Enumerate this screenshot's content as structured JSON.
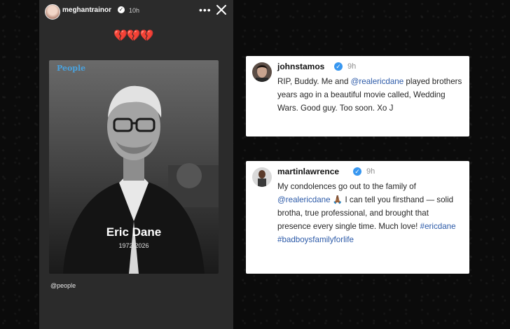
{
  "story": {
    "username": "meghantrainor",
    "time": "10h",
    "more_label": "•••",
    "hearts": "💔💔💔",
    "logo": "People",
    "caption_name": "Eric Dane",
    "caption_years": "1972-2026",
    "credit": "@people"
  },
  "comments": [
    {
      "username": "johnstamos",
      "time": "9h",
      "text_parts": [
        "RIP, Buddy.  Me and ",
        "@realericdane",
        " played brothers years ago in a beautiful movie called, Wedding Wars.  Good guy.  Too soon. Xo J"
      ]
    },
    {
      "username": "martinlawrence",
      "time": "9h",
      "text_parts": [
        "My condolences go out to the family of ",
        "@realericdane",
        " 🙏🏾 I can tell you firsthand — solid brotha, true professional, and brought that presence every single time. Much love! ",
        "#ericdane",
        " ",
        "#badboysfamilyforlife"
      ]
    }
  ],
  "colors": {
    "background": "#0b0b0b",
    "story_bg": "#2b2b2b",
    "verified_blue": "#3897f0",
    "mention_blue": "#2c5aa8",
    "heart_red": "#e63946"
  },
  "icons": {
    "close": "close-icon",
    "more": "more-options-icon",
    "verified": "verified-badge-icon"
  }
}
